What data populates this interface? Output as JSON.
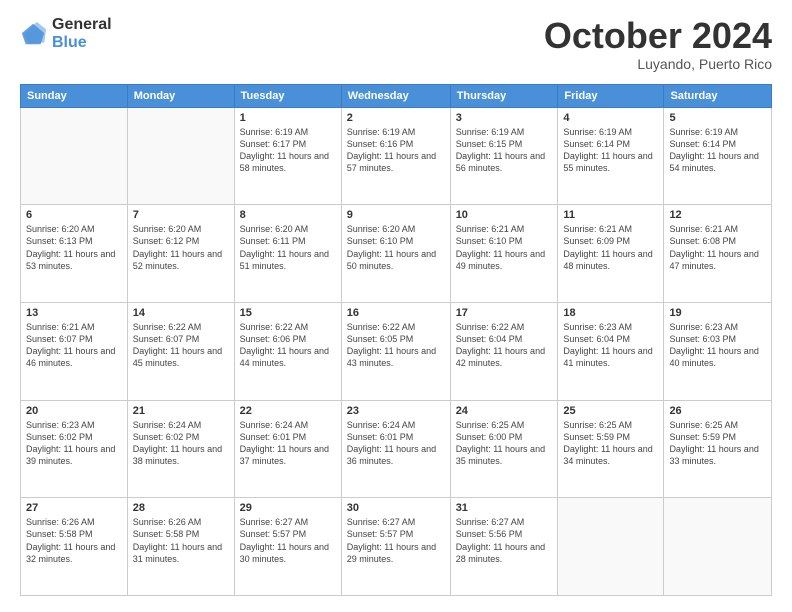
{
  "header": {
    "logo_line1": "General",
    "logo_line2": "Blue",
    "month": "October 2024",
    "location": "Luyando, Puerto Rico"
  },
  "days_of_week": [
    "Sunday",
    "Monday",
    "Tuesday",
    "Wednesday",
    "Thursday",
    "Friday",
    "Saturday"
  ],
  "weeks": [
    [
      {
        "day": "",
        "info": ""
      },
      {
        "day": "",
        "info": ""
      },
      {
        "day": "1",
        "info": "Sunrise: 6:19 AM\nSunset: 6:17 PM\nDaylight: 11 hours and 58 minutes."
      },
      {
        "day": "2",
        "info": "Sunrise: 6:19 AM\nSunset: 6:16 PM\nDaylight: 11 hours and 57 minutes."
      },
      {
        "day": "3",
        "info": "Sunrise: 6:19 AM\nSunset: 6:15 PM\nDaylight: 11 hours and 56 minutes."
      },
      {
        "day": "4",
        "info": "Sunrise: 6:19 AM\nSunset: 6:14 PM\nDaylight: 11 hours and 55 minutes."
      },
      {
        "day": "5",
        "info": "Sunrise: 6:19 AM\nSunset: 6:14 PM\nDaylight: 11 hours and 54 minutes."
      }
    ],
    [
      {
        "day": "6",
        "info": "Sunrise: 6:20 AM\nSunset: 6:13 PM\nDaylight: 11 hours and 53 minutes."
      },
      {
        "day": "7",
        "info": "Sunrise: 6:20 AM\nSunset: 6:12 PM\nDaylight: 11 hours and 52 minutes."
      },
      {
        "day": "8",
        "info": "Sunrise: 6:20 AM\nSunset: 6:11 PM\nDaylight: 11 hours and 51 minutes."
      },
      {
        "day": "9",
        "info": "Sunrise: 6:20 AM\nSunset: 6:10 PM\nDaylight: 11 hours and 50 minutes."
      },
      {
        "day": "10",
        "info": "Sunrise: 6:21 AM\nSunset: 6:10 PM\nDaylight: 11 hours and 49 minutes."
      },
      {
        "day": "11",
        "info": "Sunrise: 6:21 AM\nSunset: 6:09 PM\nDaylight: 11 hours and 48 minutes."
      },
      {
        "day": "12",
        "info": "Sunrise: 6:21 AM\nSunset: 6:08 PM\nDaylight: 11 hours and 47 minutes."
      }
    ],
    [
      {
        "day": "13",
        "info": "Sunrise: 6:21 AM\nSunset: 6:07 PM\nDaylight: 11 hours and 46 minutes."
      },
      {
        "day": "14",
        "info": "Sunrise: 6:22 AM\nSunset: 6:07 PM\nDaylight: 11 hours and 45 minutes."
      },
      {
        "day": "15",
        "info": "Sunrise: 6:22 AM\nSunset: 6:06 PM\nDaylight: 11 hours and 44 minutes."
      },
      {
        "day": "16",
        "info": "Sunrise: 6:22 AM\nSunset: 6:05 PM\nDaylight: 11 hours and 43 minutes."
      },
      {
        "day": "17",
        "info": "Sunrise: 6:22 AM\nSunset: 6:04 PM\nDaylight: 11 hours and 42 minutes."
      },
      {
        "day": "18",
        "info": "Sunrise: 6:23 AM\nSunset: 6:04 PM\nDaylight: 11 hours and 41 minutes."
      },
      {
        "day": "19",
        "info": "Sunrise: 6:23 AM\nSunset: 6:03 PM\nDaylight: 11 hours and 40 minutes."
      }
    ],
    [
      {
        "day": "20",
        "info": "Sunrise: 6:23 AM\nSunset: 6:02 PM\nDaylight: 11 hours and 39 minutes."
      },
      {
        "day": "21",
        "info": "Sunrise: 6:24 AM\nSunset: 6:02 PM\nDaylight: 11 hours and 38 minutes."
      },
      {
        "day": "22",
        "info": "Sunrise: 6:24 AM\nSunset: 6:01 PM\nDaylight: 11 hours and 37 minutes."
      },
      {
        "day": "23",
        "info": "Sunrise: 6:24 AM\nSunset: 6:01 PM\nDaylight: 11 hours and 36 minutes."
      },
      {
        "day": "24",
        "info": "Sunrise: 6:25 AM\nSunset: 6:00 PM\nDaylight: 11 hours and 35 minutes."
      },
      {
        "day": "25",
        "info": "Sunrise: 6:25 AM\nSunset: 5:59 PM\nDaylight: 11 hours and 34 minutes."
      },
      {
        "day": "26",
        "info": "Sunrise: 6:25 AM\nSunset: 5:59 PM\nDaylight: 11 hours and 33 minutes."
      }
    ],
    [
      {
        "day": "27",
        "info": "Sunrise: 6:26 AM\nSunset: 5:58 PM\nDaylight: 11 hours and 32 minutes."
      },
      {
        "day": "28",
        "info": "Sunrise: 6:26 AM\nSunset: 5:58 PM\nDaylight: 11 hours and 31 minutes."
      },
      {
        "day": "29",
        "info": "Sunrise: 6:27 AM\nSunset: 5:57 PM\nDaylight: 11 hours and 30 minutes."
      },
      {
        "day": "30",
        "info": "Sunrise: 6:27 AM\nSunset: 5:57 PM\nDaylight: 11 hours and 29 minutes."
      },
      {
        "day": "31",
        "info": "Sunrise: 6:27 AM\nSunset: 5:56 PM\nDaylight: 11 hours and 28 minutes."
      },
      {
        "day": "",
        "info": ""
      },
      {
        "day": "",
        "info": ""
      }
    ]
  ]
}
